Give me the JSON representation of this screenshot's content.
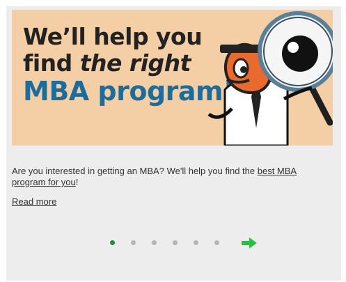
{
  "banner": {
    "line1": "We’ll help you",
    "line2_prefix": "find ",
    "line2_emphasis": "the right",
    "line3": "MBA program!"
  },
  "description": {
    "text": "Are you interested in getting an MBA? We'll help you find the ",
    "link": "best MBA program for you",
    "suffix": "!"
  },
  "read_more": "Read more",
  "carousel": {
    "dots": 6,
    "active_index": 0,
    "active_color": "#1f8f2f",
    "inactive_color": "#b5b5b5",
    "next_icon": "green-right-arrow"
  }
}
